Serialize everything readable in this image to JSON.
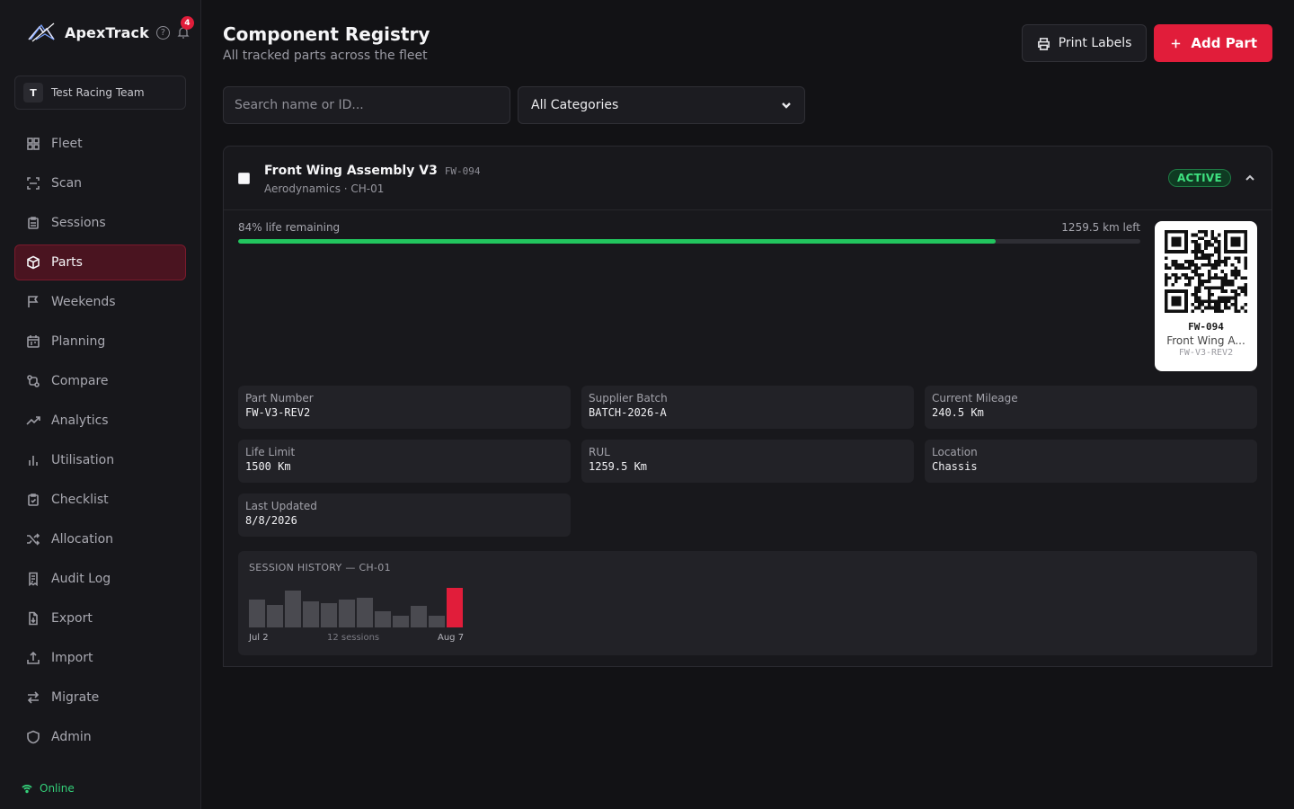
{
  "brand": {
    "name": "ApexTrack",
    "notifications": "4",
    "help_glyph": "?"
  },
  "team": {
    "initial": "T",
    "name": "Test Racing Team"
  },
  "nav": [
    {
      "label": "Fleet",
      "icon": "grid-icon",
      "active": false
    },
    {
      "label": "Scan",
      "icon": "scan-icon",
      "active": false
    },
    {
      "label": "Sessions",
      "icon": "clipboard-icon",
      "active": false
    },
    {
      "label": "Parts",
      "icon": "package-icon",
      "active": true
    },
    {
      "label": "Weekends",
      "icon": "flag-icon",
      "active": false
    },
    {
      "label": "Planning",
      "icon": "calendar-icon",
      "active": false
    },
    {
      "label": "Compare",
      "icon": "compare-icon",
      "active": false
    },
    {
      "label": "Analytics",
      "icon": "trending-icon",
      "active": false
    },
    {
      "label": "Utilisation",
      "icon": "bar-chart-icon",
      "active": false
    },
    {
      "label": "Checklist",
      "icon": "checklist-icon",
      "active": false
    },
    {
      "label": "Allocation",
      "icon": "shuffle-icon",
      "active": false
    },
    {
      "label": "Audit Log",
      "icon": "receipt-icon",
      "active": false
    },
    {
      "label": "Export",
      "icon": "file-export-icon",
      "active": false
    },
    {
      "label": "Import",
      "icon": "upload-icon",
      "active": false
    },
    {
      "label": "Migrate",
      "icon": "swap-icon",
      "active": false
    },
    {
      "label": "Admin",
      "icon": "shield-icon",
      "active": false
    }
  ],
  "status": {
    "label": "Online",
    "color": "#34d17a"
  },
  "page": {
    "title": "Component Registry",
    "subtitle": "All tracked parts across the fleet"
  },
  "actions": {
    "print_label": "Print Labels",
    "add_label": "Add Part"
  },
  "filters": {
    "search_placeholder": "Search name or ID...",
    "search_value": "",
    "category_selected": "All Categories"
  },
  "part": {
    "name": "Front Wing Assembly V3",
    "id": "FW-094",
    "meta": "Aerodynamics · CH-01",
    "status": "ACTIVE",
    "life_label": "84% life remaining",
    "life_fraction": 0.84,
    "remaining_label": "1259.5 km left",
    "qr": {
      "id": "FW-094",
      "name": "Front Wing A...",
      "part_number": "FW-V3-REV2"
    },
    "fields": [
      {
        "label": "Part Number",
        "value": "FW-V3-REV2"
      },
      {
        "label": "Supplier Batch",
        "value": "BATCH-2026-A"
      },
      {
        "label": "Current Mileage",
        "value": "240.5 Km"
      },
      {
        "label": "Life Limit",
        "value": "1500 Km"
      },
      {
        "label": "RUL",
        "value": "1259.5 Km"
      },
      {
        "label": "Location",
        "value": "Chassis"
      },
      {
        "label": "Last Updated",
        "value": "8/8/2026"
      }
    ],
    "history": {
      "title": "SESSION HISTORY — CH-01",
      "start_label": "Jul 2",
      "count_label": "12 sessions",
      "end_label": "Aug 7",
      "session_values": [
        0.7,
        0.57,
        0.93,
        0.65,
        0.61,
        0.7,
        0.75,
        0.41,
        0.3,
        0.55,
        0.3,
        1.0
      ],
      "highlight_color": "#e11d3a",
      "bar_color": "#4a4a50"
    }
  },
  "accent": "#e11d3a"
}
